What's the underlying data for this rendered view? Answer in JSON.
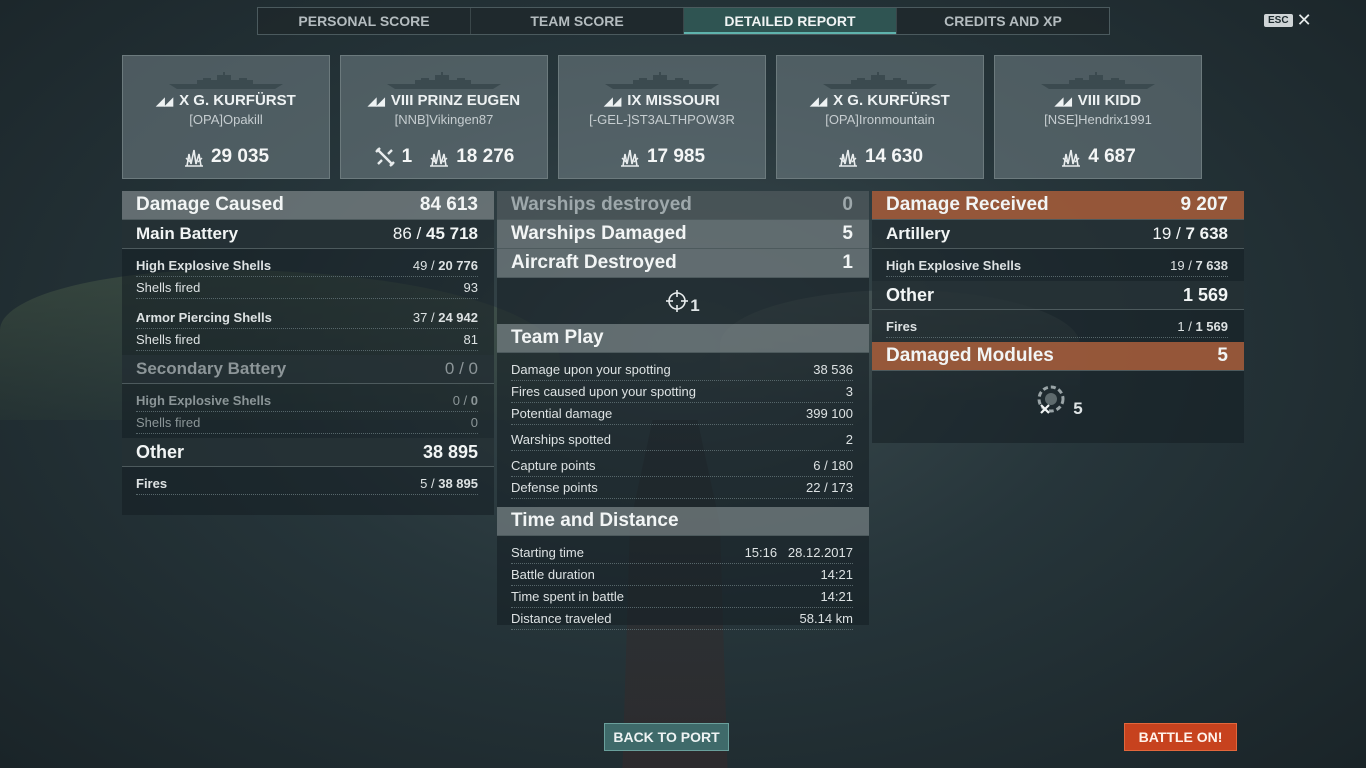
{
  "tabs": [
    {
      "label": "PERSONAL SCORE",
      "active": false
    },
    {
      "label": "TEAM SCORE",
      "active": false
    },
    {
      "label": "DETAILED REPORT",
      "active": true
    },
    {
      "label": "CREDITS AND XP",
      "active": false
    }
  ],
  "esc_label": "ESC",
  "players": [
    {
      "ship": "X G. KURFÜRST",
      "player": "[OPA]Opakill",
      "planes": "",
      "damage": "29 035",
      "icon": "battleship-icon"
    },
    {
      "ship": "VIII PRINZ EUGEN",
      "player": "[NNB]Vikingen87",
      "planes": "1",
      "damage": "18 276",
      "icon": "cruiser-icon"
    },
    {
      "ship": "IX MISSOURI",
      "player": "[-GEL-]ST3ALTHPOW3R",
      "planes": "",
      "damage": "17 985",
      "icon": "battleship-icon"
    },
    {
      "ship": "X G. KURFÜRST",
      "player": "[OPA]Ironmountain",
      "planes": "",
      "damage": "14 630",
      "icon": "battleship-icon"
    },
    {
      "ship": "VIII KIDD",
      "player": "[NSE]Hendrix1991",
      "planes": "",
      "damage": "4 687",
      "icon": "destroyer-icon"
    }
  ],
  "damage_caused": {
    "label": "Damage Caused",
    "value": "84 613",
    "main_battery": {
      "label": "Main Battery",
      "hits": "86",
      "damage": "45 718"
    },
    "main_rows": [
      {
        "label": "High Explosive Shells",
        "hits": "49",
        "damage": "20 776",
        "bold": true
      },
      {
        "label": "Shells fired",
        "value": "93",
        "bold": false
      },
      {
        "label": "Armor Piercing Shells",
        "hits": "37",
        "damage": "24 942",
        "bold": true
      },
      {
        "label": "Shells fired",
        "value": "81",
        "bold": false
      }
    ],
    "secondary": {
      "label": "Secondary Battery",
      "value": "0 / 0"
    },
    "secondary_rows": [
      {
        "label": "High Explosive Shells",
        "hits": "0",
        "damage": "0"
      },
      {
        "label": "Shells fired",
        "value": "0"
      }
    ],
    "other": {
      "label": "Other",
      "value": "38 895"
    },
    "fires": {
      "label": "Fires",
      "hits": "5",
      "damage": "38 895"
    }
  },
  "center": {
    "warships_destroyed": {
      "label": "Warships destroyed",
      "value": "0"
    },
    "warships_damaged": {
      "label": "Warships Damaged",
      "value": "5"
    },
    "aircraft_destroyed": {
      "label": "Aircraft Destroyed",
      "value": "1"
    },
    "aircraft_icon_count": "1",
    "team_play": {
      "label": "Team Play",
      "rows": [
        {
          "label": "Damage upon your spotting",
          "value": "38 536"
        },
        {
          "label": "Fires caused upon your spotting",
          "value": "3"
        },
        {
          "label": "Potential damage",
          "value": "399 100"
        },
        {
          "label": "Warships spotted",
          "value": "2"
        },
        {
          "label": "Capture points",
          "value": "6 / 180"
        },
        {
          "label": "Defense points",
          "value": "22 / 173"
        }
      ]
    },
    "time_distance": {
      "label": "Time and Distance",
      "rows": [
        {
          "label": "Starting time",
          "value": "15:16   28.12.2017"
        },
        {
          "label": "Battle duration",
          "value": "14:21"
        },
        {
          "label": "Time spent in battle",
          "value": "14:21"
        },
        {
          "label": "Distance traveled",
          "value": "58.14 km"
        }
      ]
    }
  },
  "damage_received": {
    "label": "Damage Received",
    "value": "9 207",
    "artillery": {
      "label": "Artillery",
      "hits": "19",
      "damage": "7 638"
    },
    "he": {
      "label": "High Explosive Shells",
      "hits": "19",
      "damage": "7 638"
    },
    "other": {
      "label": "Other",
      "value": "1 569"
    },
    "fires": {
      "label": "Fires",
      "hits": "1",
      "damage": "1 569"
    },
    "modules": {
      "label": "Damaged Modules",
      "value": "5"
    },
    "modules_icon_count": "5"
  },
  "buttons": {
    "back": "BACK TO PORT",
    "battle": "BATTLE ON!"
  },
  "colors": {
    "accent_teal": "#3f6a6a",
    "battle_orange": "#c7421e",
    "received_header": "#aa5f3c"
  }
}
